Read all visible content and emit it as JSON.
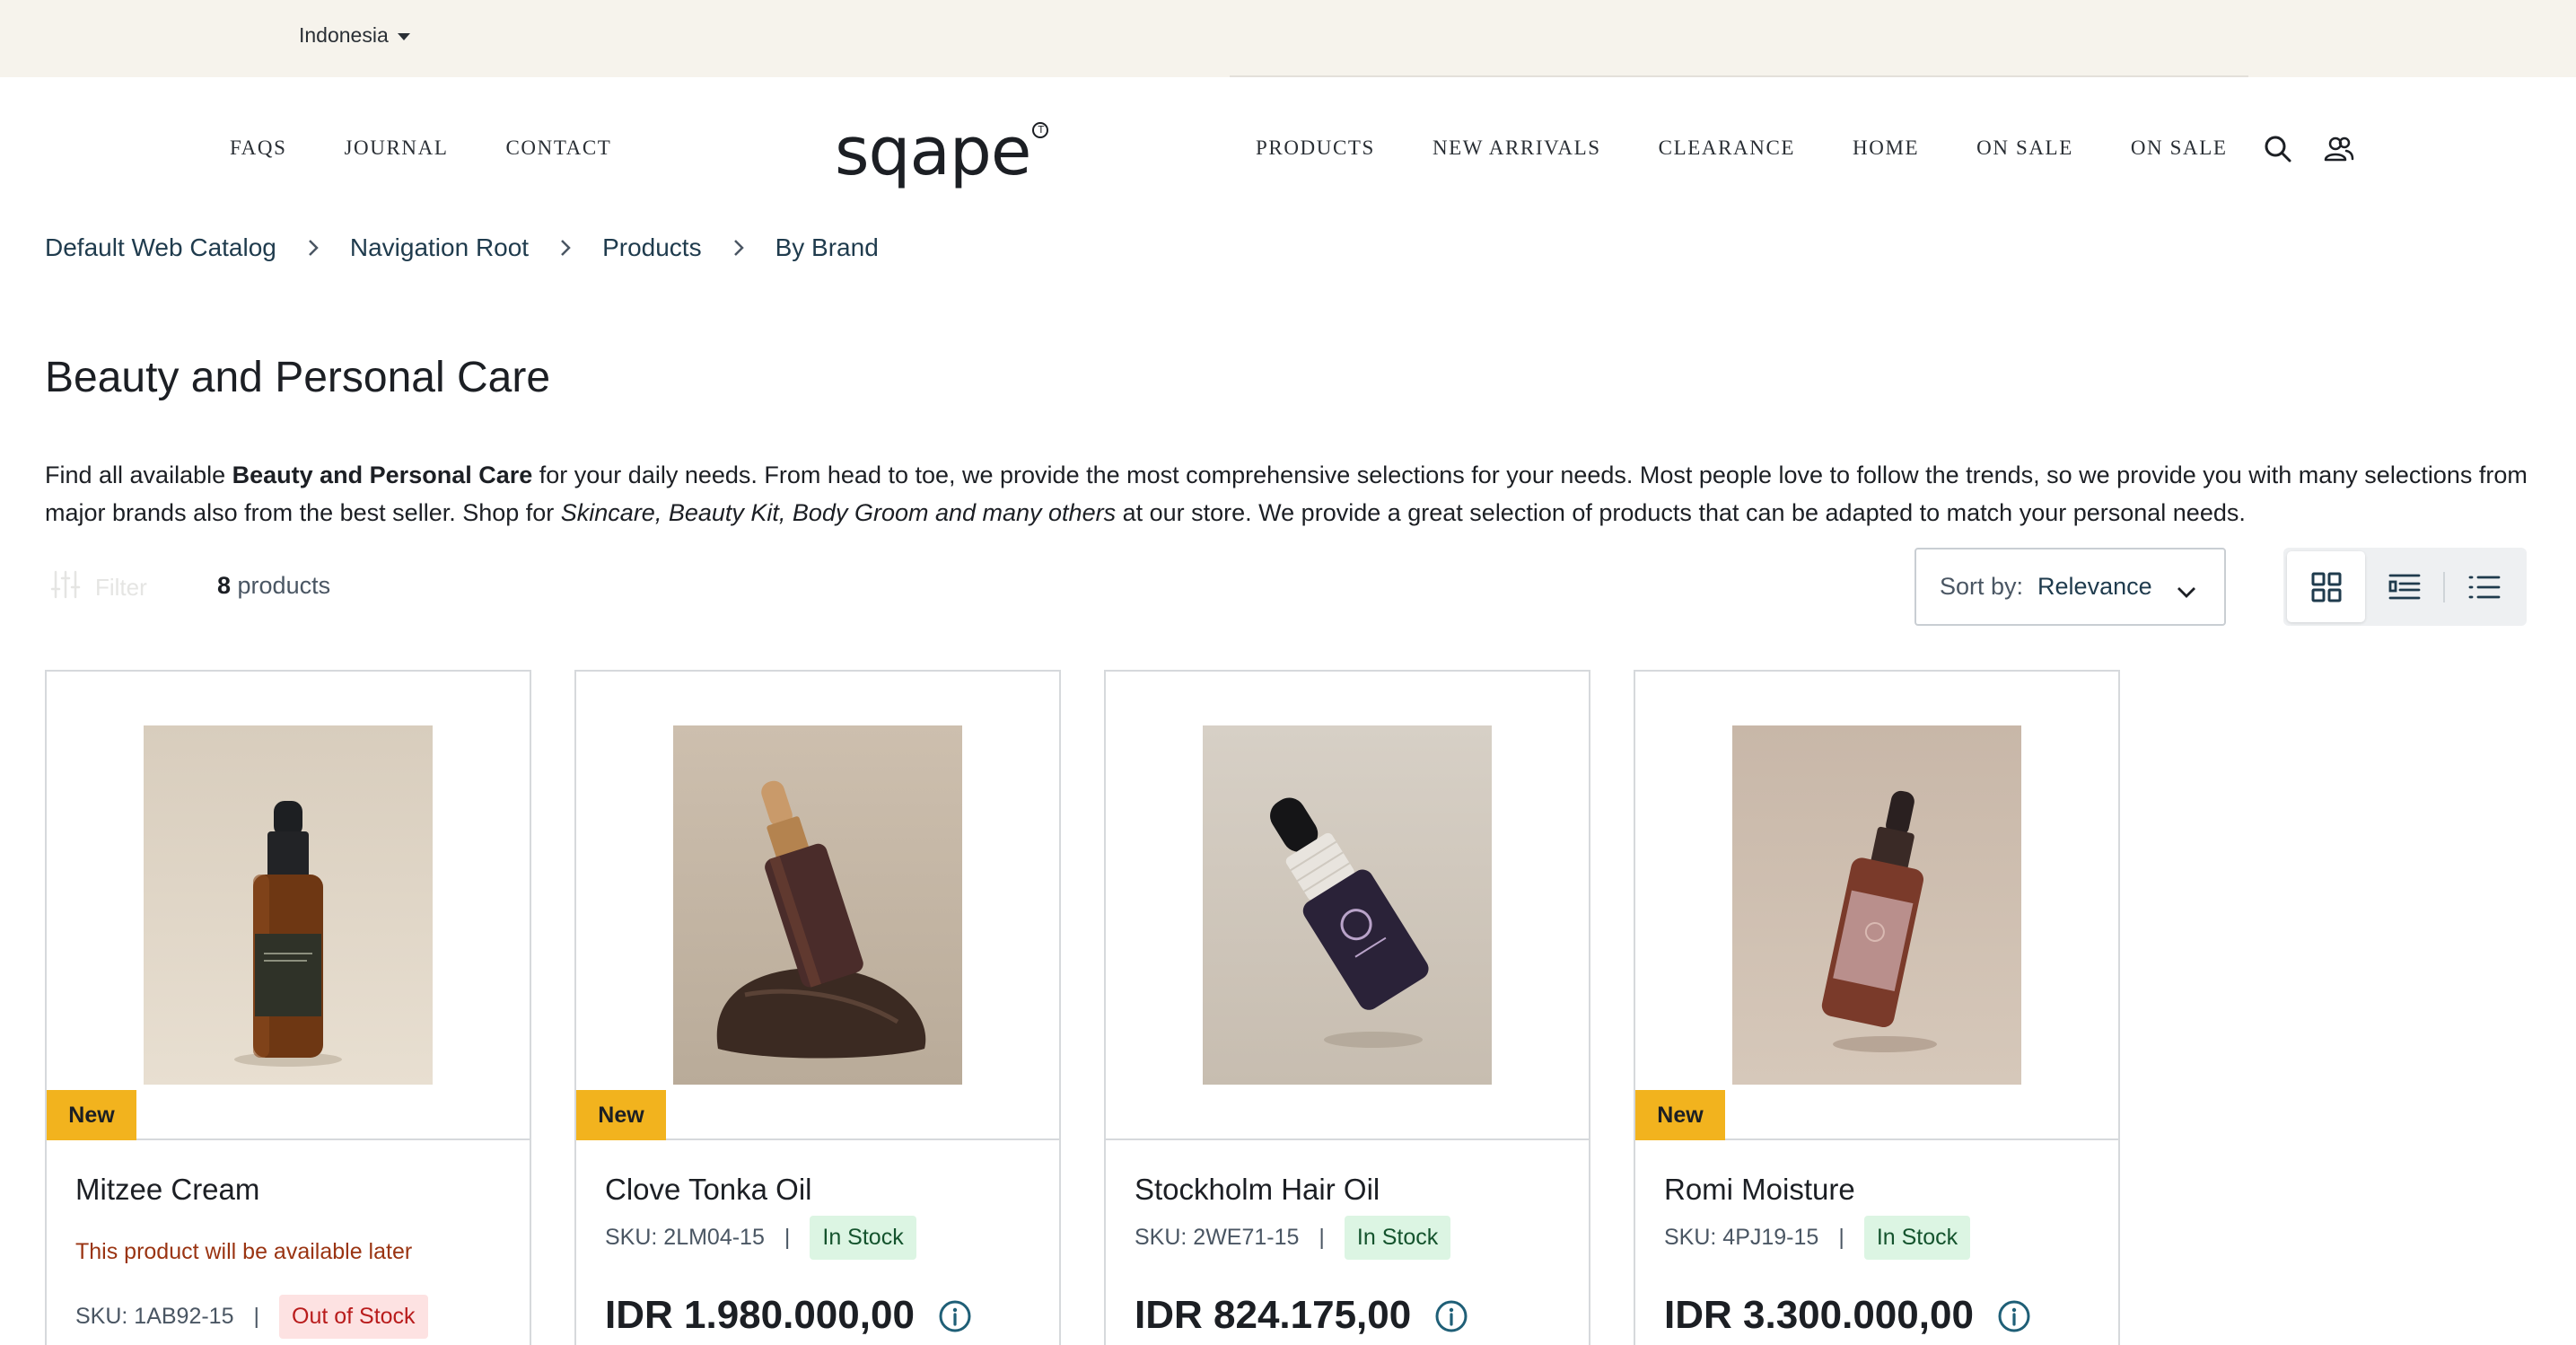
{
  "topbar": {
    "region": "Indonesia"
  },
  "header": {
    "logo": "sqape",
    "logo_mark": "T",
    "nav_left": [
      "FAQS",
      "JOURNAL",
      "CONTACT"
    ],
    "nav_right": [
      "PRODUCTS",
      "NEW ARRIVALS",
      "CLEARANCE",
      "HOME",
      "ON SALE",
      "ON SALE"
    ]
  },
  "breadcrumb": [
    "Default Web Catalog",
    "Navigation Root",
    "Products",
    "By Brand"
  ],
  "page": {
    "title": "Beauty and Personal Care",
    "description": {
      "p1": "Find all available ",
      "bold": "Beauty and Personal Care",
      "p2": " for your daily needs. From head to toe, we provide the most comprehensive selections for your needs. Most people love to follow the trends, so we provide you with many selections from major brands also from the best seller. Shop for ",
      "italic": "Skincare, Beauty Kit, Body Groom and many others",
      "p3": " at our store. We provide a great selection of products that can be adapted to match your personal needs."
    }
  },
  "toolbar": {
    "filter_label": "Filter",
    "count_number": "8",
    "count_label": " products",
    "sort_label": "Sort by:",
    "sort_value": "Relevance"
  },
  "products": [
    {
      "name": "Mitzee Cream",
      "badge": "New",
      "note": "This product will be available later",
      "sku": "SKU: 1AB92-15",
      "stock": "Out of Stock"
    },
    {
      "name": "Clove Tonka Oil",
      "badge": "New",
      "sku": "SKU: 2LM04-15",
      "stock": "In Stock",
      "price": "IDR 1.980.000,00"
    },
    {
      "name": "Stockholm Hair Oil",
      "sku": "SKU: 2WE71-15",
      "stock": "In Stock",
      "price": "IDR 824.175,00"
    },
    {
      "name": "Romi Moisture",
      "badge": "New",
      "sku": "SKU: 4PJ19-15",
      "stock": "In Stock",
      "price": "IDR 3.300.000,00"
    }
  ],
  "colors": {
    "badge_new": "#f2b31e",
    "in_stock_bg": "#dcf5e3",
    "out_stock_bg": "#fde2e2",
    "topbar_bg": "#f6f3ec"
  },
  "icons": [
    "chevron-down-icon",
    "search-icon",
    "account-icon",
    "chevron-right-icon",
    "filter-icon",
    "grid-view-icon",
    "list-view-icon",
    "compact-list-icon",
    "info-icon"
  ]
}
